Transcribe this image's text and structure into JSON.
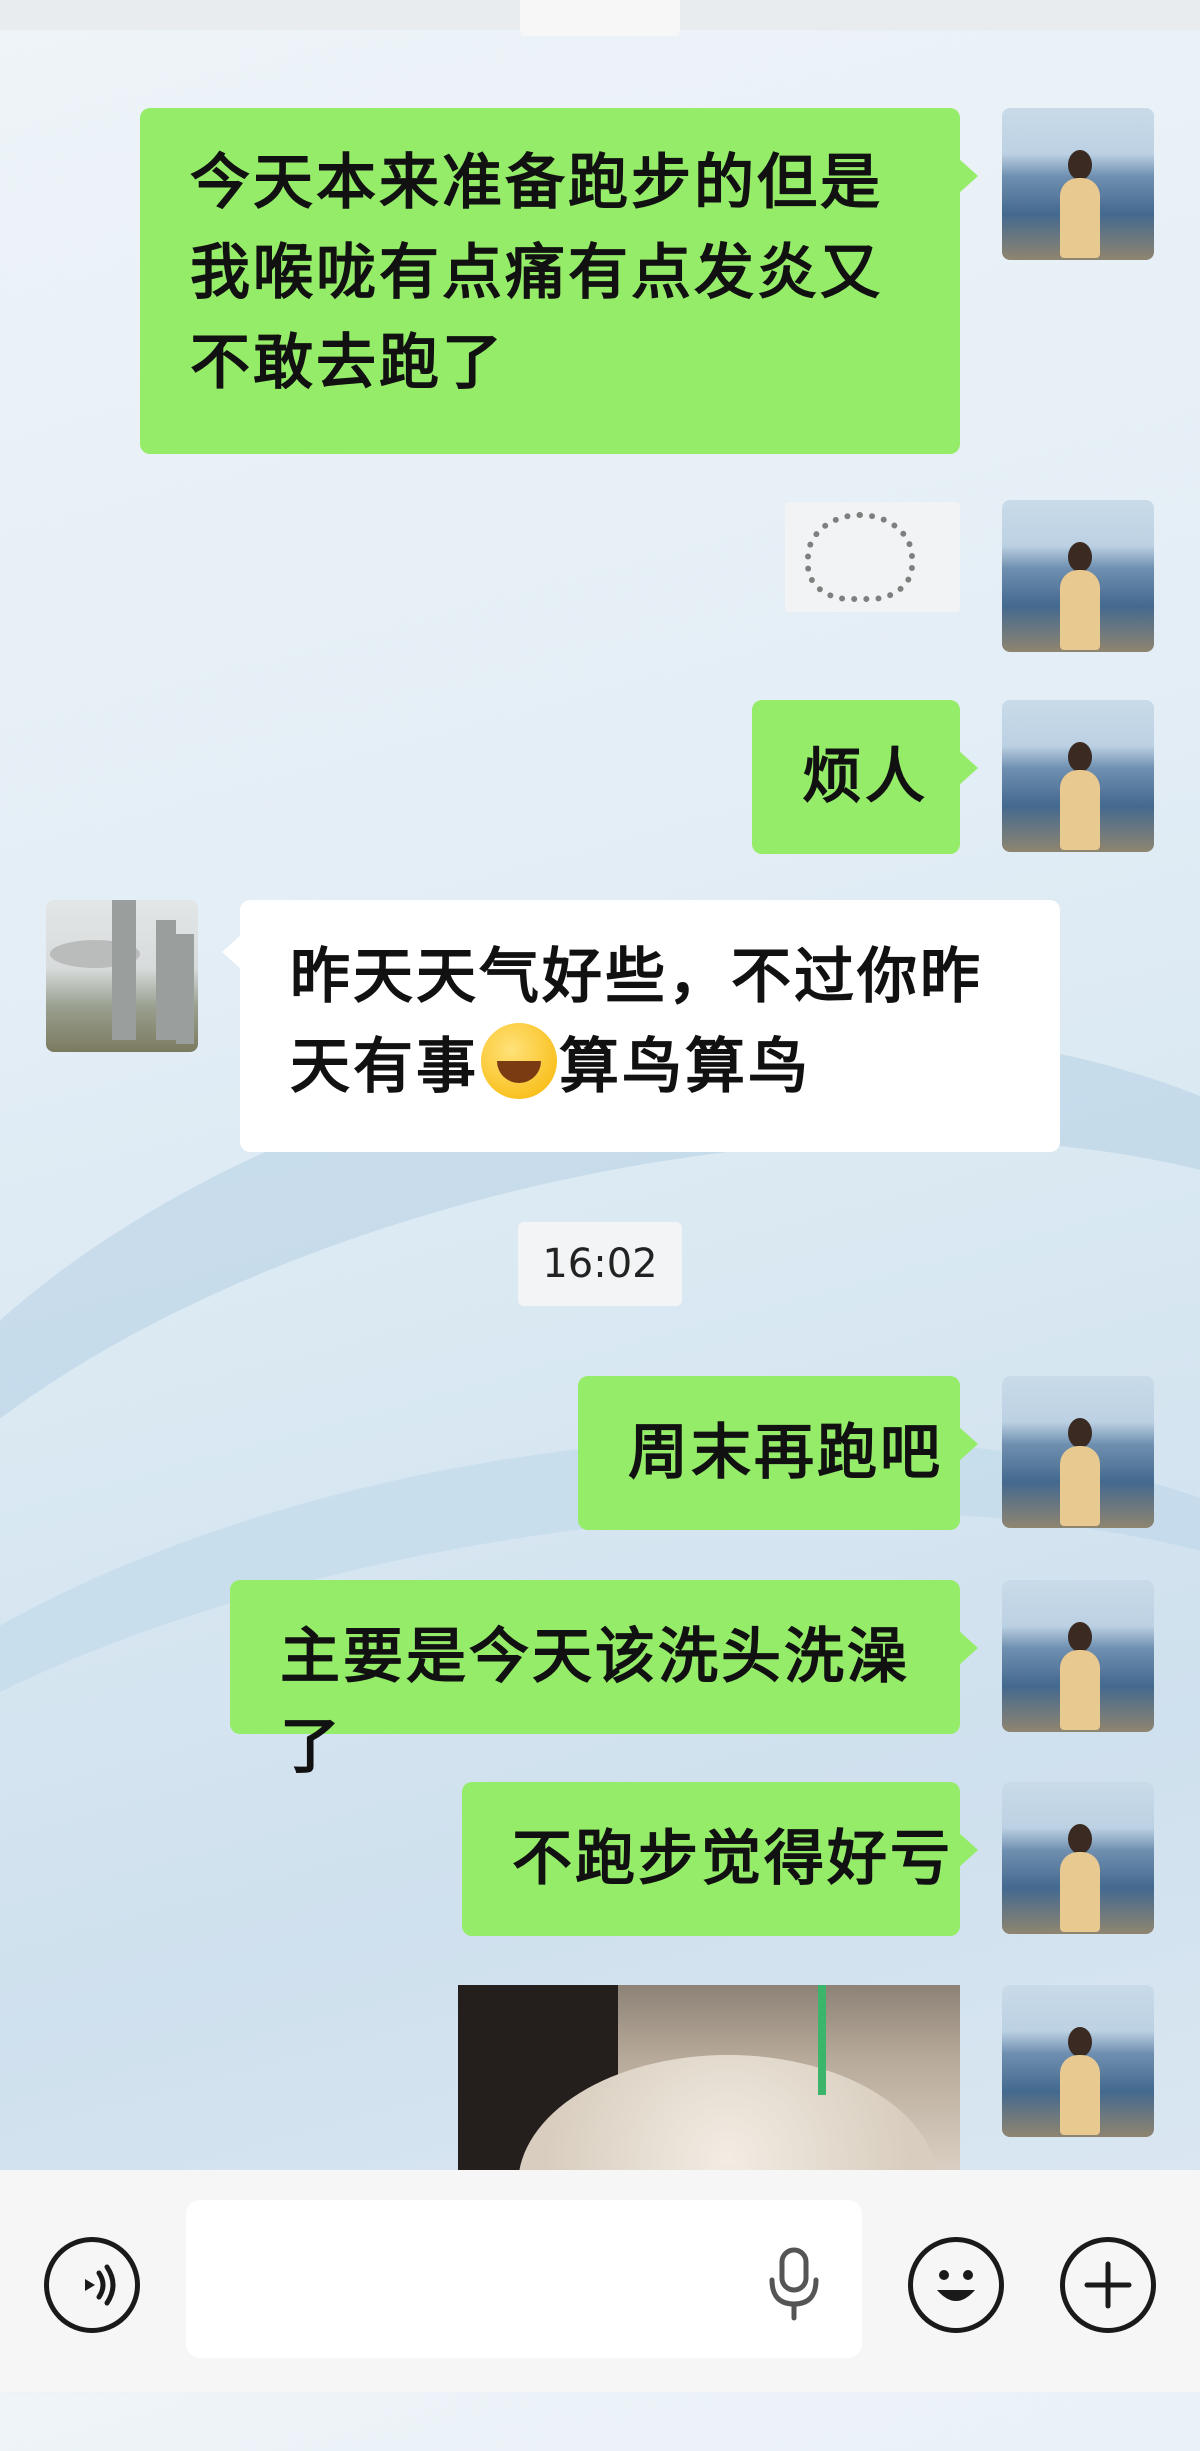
{
  "messages": [
    {
      "id": "m1",
      "side": "right",
      "text": "今天本来准备跑步的但是我喉咙有点痛有点发炎又不敢去跑了"
    },
    {
      "id": "m2",
      "side": "right",
      "type": "sticker"
    },
    {
      "id": "m3",
      "side": "right",
      "text": "烦人"
    },
    {
      "id": "m4",
      "side": "left",
      "text_before_emoji": "昨天天气好些，不过你昨天有事",
      "emoji": "tears-of-joy",
      "text_after_emoji": "算鸟算鸟"
    },
    {
      "id": "m5",
      "side": "right",
      "text": "周末再跑吧"
    },
    {
      "id": "m6",
      "side": "right",
      "text": "主要是今天该洗头洗澡了"
    },
    {
      "id": "m7",
      "side": "right",
      "text": "不跑步觉得好亏"
    },
    {
      "id": "m8",
      "side": "right",
      "type": "photo"
    }
  ],
  "timestamp": "16:02",
  "input_bar": {
    "placeholder": "",
    "icons": [
      "voice-mode-icon",
      "microphone-icon",
      "emoji-icon",
      "plus-icon"
    ]
  },
  "colors": {
    "my_bubble": "#95ec69",
    "their_bubble": "#ffffff",
    "input_bar_bg": "#f6f6f6"
  }
}
